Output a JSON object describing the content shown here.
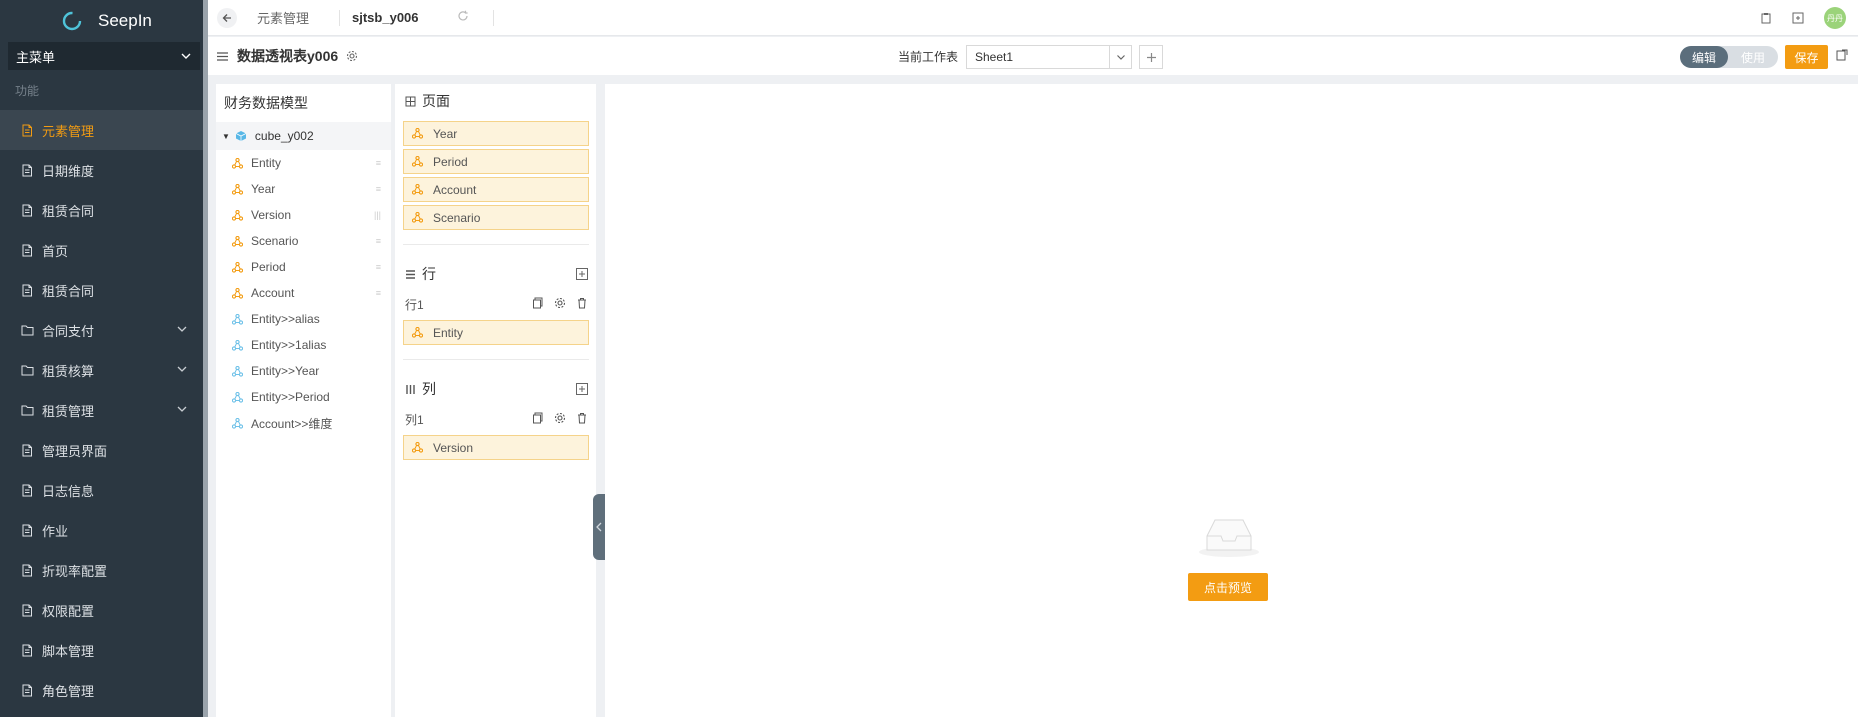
{
  "app": {
    "brand": "SeepIn"
  },
  "sidebar": {
    "menu_select": "主菜单",
    "section": "功能",
    "items": [
      {
        "label": "元素管理",
        "icon": "document-icon",
        "active": true
      },
      {
        "label": "日期维度",
        "icon": "document-icon"
      },
      {
        "label": "租赁合同",
        "icon": "document-icon"
      },
      {
        "label": "首页",
        "icon": "document-icon"
      },
      {
        "label": "租赁合同",
        "icon": "document-icon"
      },
      {
        "label": "合同支付",
        "icon": "folder-icon",
        "expandable": true
      },
      {
        "label": "租赁核算",
        "icon": "folder-icon",
        "expandable": true
      },
      {
        "label": "租赁管理",
        "icon": "folder-icon",
        "expandable": true
      },
      {
        "label": "管理员界面",
        "icon": "document-icon"
      },
      {
        "label": "日志信息",
        "icon": "document-icon"
      },
      {
        "label": "作业",
        "icon": "document-icon"
      },
      {
        "label": "折现率配置",
        "icon": "document-icon"
      },
      {
        "label": "权限配置",
        "icon": "document-icon"
      },
      {
        "label": "脚本管理",
        "icon": "document-icon"
      },
      {
        "label": "角色管理",
        "icon": "document-icon"
      }
    ]
  },
  "topbar": {
    "tabs": [
      {
        "label": "元素管理",
        "active": false
      },
      {
        "label": "sjtsb_y006",
        "active": true
      }
    ],
    "avatar_text": "丹丹"
  },
  "toolbar": {
    "title": "数据透视表y006",
    "sheet_label": "当前工作表",
    "sheet_value": "Sheet1",
    "mode_edit": "编辑",
    "mode_use": "使用",
    "save_label": "保存"
  },
  "model": {
    "title": "财务数据模型",
    "cube": "cube_y002",
    "dimensions": [
      {
        "label": "Entity",
        "kind": "dimension"
      },
      {
        "label": "Year",
        "kind": "dimension"
      },
      {
        "label": "Version",
        "kind": "dimension"
      },
      {
        "label": "Scenario",
        "kind": "dimension"
      },
      {
        "label": "Period",
        "kind": "dimension"
      },
      {
        "label": "Account",
        "kind": "dimension"
      },
      {
        "label": "Entity>>alias",
        "kind": "attribute"
      },
      {
        "label": "Entity>>1alias",
        "kind": "attribute"
      },
      {
        "label": "Entity>>Year",
        "kind": "attribute"
      },
      {
        "label": "Entity>>Period",
        "kind": "attribute"
      },
      {
        "label": "Account>>维度",
        "kind": "attribute"
      }
    ]
  },
  "fields": {
    "page": {
      "title": "页面",
      "items": [
        "Year",
        "Period",
        "Account",
        "Scenario"
      ]
    },
    "rows": {
      "title": "行",
      "sub_label": "行1",
      "items": [
        "Entity"
      ]
    },
    "cols": {
      "title": "列",
      "sub_label": "列1",
      "items": [
        "Version"
      ]
    }
  },
  "preview": {
    "button_label": "点击预览"
  },
  "colors": {
    "accent": "#f39c12",
    "sidebar_bg": "#2b3741",
    "chip_bg": "#fdf3dc",
    "chip_border": "#f5d38a"
  }
}
